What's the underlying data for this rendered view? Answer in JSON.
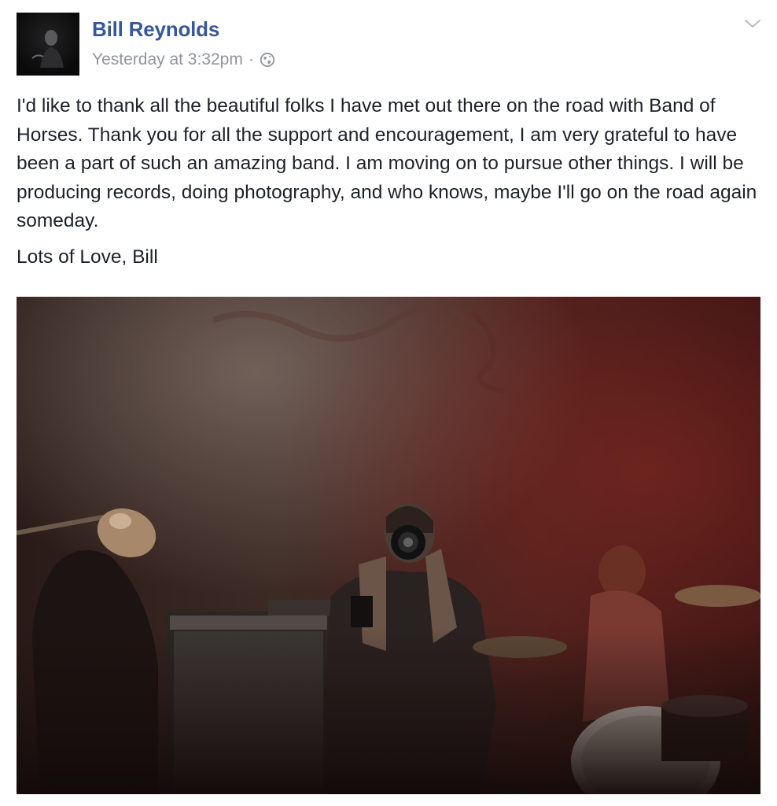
{
  "post": {
    "author": "Bill Reynolds",
    "timestamp": "Yesterday at 3:32pm",
    "separator": "·",
    "privacy_icon": "globe-icon",
    "menu_icon": "chevron-down-icon",
    "body_paragraphs": [
      "I'd like to thank all the beautiful folks I have met out there on the road with Band of Horses. Thank you for all the support and encouragement, I am very grateful to have been a part of such an amazing band. I am moving on to pursue other things. I will be producing records, doing photography, and who knows, maybe I'll go on the road again someday.",
      "Lots of Love, Bill"
    ],
    "photo_description_icon": "concert-photo",
    "colors": {
      "name_link": "#365899",
      "meta_text": "#90949c",
      "body_text": "#1d2129"
    }
  }
}
